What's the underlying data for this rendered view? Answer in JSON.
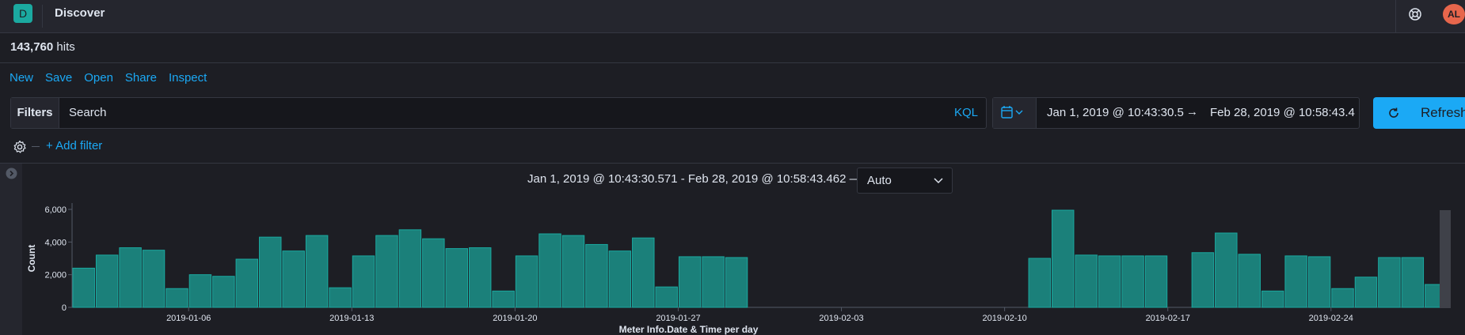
{
  "app": {
    "logo_letter": "D",
    "title": "Discover",
    "avatar_initials": "AL",
    "accent": "#1ba9f5",
    "bar_color": "#1ba9a0"
  },
  "hits": {
    "count": "143,760",
    "label": "hits"
  },
  "menu": {
    "items": [
      "New",
      "Save",
      "Open",
      "Share",
      "Inspect"
    ]
  },
  "query": {
    "filters_label": "Filters",
    "search_placeholder": "Search",
    "language": "KQL"
  },
  "datepicker": {
    "start": "Jan 1, 2019 @ 10:43:30.5",
    "arrow": "→",
    "end": "Feb 28, 2019 @ 10:58:43.4",
    "icon": "calendar-icon"
  },
  "refresh": {
    "label": "Refresh",
    "icon": "refresh-icon"
  },
  "filter_row": {
    "add_filter": "+ Add filter",
    "settings_icon": "gear-icon"
  },
  "histogram": {
    "header": "Jan 1, 2019 @ 10:43:30.571 - Feb 28, 2019 @ 10:58:43.462 —",
    "interval": "Auto"
  },
  "chart_data": {
    "type": "bar",
    "xlabel": "Meter Info.Date & Time per day",
    "ylabel": "Count",
    "ylim": [
      0,
      6000
    ],
    "yticks": [
      0,
      2000,
      4000,
      6000
    ],
    "ytick_labels": [
      "0",
      "2,000",
      "4,000",
      "6,000"
    ],
    "xtick_labels": [
      {
        "date": "2019-01-06",
        "label": "2019-01-06"
      },
      {
        "date": "2019-01-13",
        "label": "2019-01-13"
      },
      {
        "date": "2019-01-20",
        "label": "2019-01-20"
      },
      {
        "date": "2019-01-27",
        "label": "2019-01-27"
      },
      {
        "date": "2019-02-03",
        "label": "2019-02-03"
      },
      {
        "date": "2019-02-10",
        "label": "2019-02-10"
      },
      {
        "date": "2019-02-17",
        "label": "2019-02-17"
      },
      {
        "date": "2019-02-24",
        "label": "2019-02-24"
      }
    ],
    "x_start": "2019-01-01",
    "x_end": "2019-03-01",
    "series": [
      {
        "values": [
          {
            "date": "2019-01-01",
            "value": 2400
          },
          {
            "date": "2019-01-02",
            "value": 3200
          },
          {
            "date": "2019-01-03",
            "value": 3650
          },
          {
            "date": "2019-01-04",
            "value": 3500
          },
          {
            "date": "2019-01-05",
            "value": 1150
          },
          {
            "date": "2019-01-06",
            "value": 2000
          },
          {
            "date": "2019-01-07",
            "value": 1900
          },
          {
            "date": "2019-01-08",
            "value": 2950
          },
          {
            "date": "2019-01-09",
            "value": 4300
          },
          {
            "date": "2019-01-10",
            "value": 3450
          },
          {
            "date": "2019-01-11",
            "value": 4400
          },
          {
            "date": "2019-01-12",
            "value": 1200
          },
          {
            "date": "2019-01-13",
            "value": 3150
          },
          {
            "date": "2019-01-14",
            "value": 4400
          },
          {
            "date": "2019-01-15",
            "value": 4750
          },
          {
            "date": "2019-01-16",
            "value": 4200
          },
          {
            "date": "2019-01-17",
            "value": 3600
          },
          {
            "date": "2019-01-18",
            "value": 3650
          },
          {
            "date": "2019-01-19",
            "value": 1000
          },
          {
            "date": "2019-01-20",
            "value": 3150
          },
          {
            "date": "2019-01-21",
            "value": 4500
          },
          {
            "date": "2019-01-22",
            "value": 4400
          },
          {
            "date": "2019-01-23",
            "value": 3850
          },
          {
            "date": "2019-01-24",
            "value": 3450
          },
          {
            "date": "2019-01-25",
            "value": 4250
          },
          {
            "date": "2019-01-26",
            "value": 1250
          },
          {
            "date": "2019-01-27",
            "value": 3100
          },
          {
            "date": "2019-01-28",
            "value": 3100
          },
          {
            "date": "2019-01-29",
            "value": 3050
          },
          {
            "date": "2019-02-11",
            "value": 3000
          },
          {
            "date": "2019-02-12",
            "value": 5950
          },
          {
            "date": "2019-02-13",
            "value": 3200
          },
          {
            "date": "2019-02-14",
            "value": 3150
          },
          {
            "date": "2019-02-15",
            "value": 3150
          },
          {
            "date": "2019-02-16",
            "value": 3150
          },
          {
            "date": "2019-02-18",
            "value": 3350
          },
          {
            "date": "2019-02-19",
            "value": 4550
          },
          {
            "date": "2019-02-20",
            "value": 3250
          },
          {
            "date": "2019-02-21",
            "value": 1000
          },
          {
            "date": "2019-02-22",
            "value": 3150
          },
          {
            "date": "2019-02-23",
            "value": 3100
          },
          {
            "date": "2019-02-24",
            "value": 1150
          },
          {
            "date": "2019-02-25",
            "value": 1850
          },
          {
            "date": "2019-02-26",
            "value": 3050
          },
          {
            "date": "2019-02-27",
            "value": 3050
          },
          {
            "date": "2019-02-28",
            "value": 1400
          }
        ]
      }
    ]
  }
}
